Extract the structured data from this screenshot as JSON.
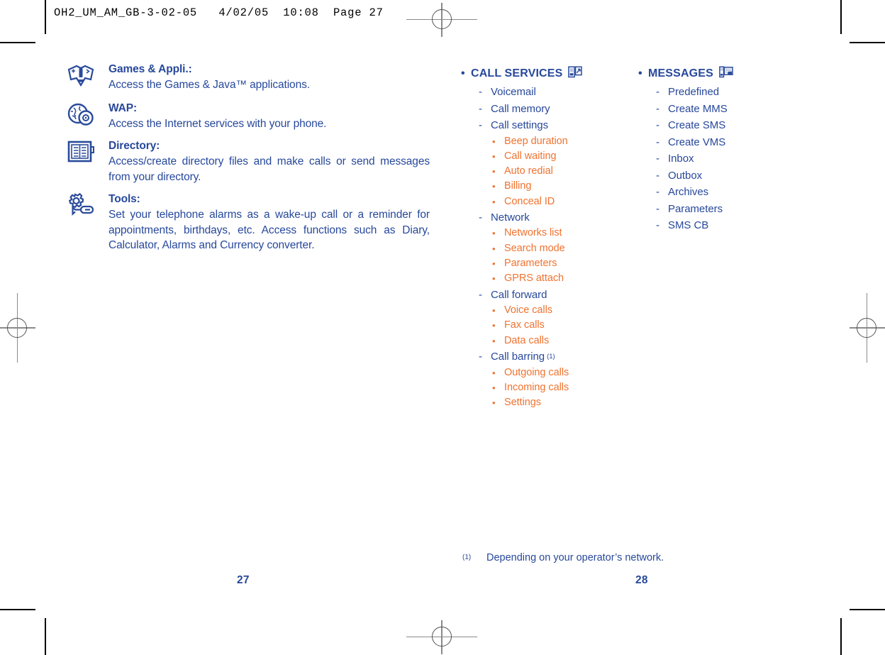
{
  "header": {
    "slug": "OH2_UM_AM_GB-3-02-05   4/02/05  10:08  Page 27"
  },
  "left_page": {
    "folio": "27",
    "features": [
      {
        "icon": "games-controller-icon",
        "title": "Games & Appli.:",
        "description": "Access the Games & Java™ applications.",
        "justify": false
      },
      {
        "icon": "wap-globe-icon",
        "title": "WAP:",
        "description": "Access the Internet services with your phone.",
        "justify": false
      },
      {
        "icon": "directory-book-icon",
        "title": "Directory:",
        "description": "Access/create directory files and make calls or send messages from your directory.",
        "justify": true
      },
      {
        "icon": "tools-gear-icon",
        "title": "Tools:",
        "description": "Set your telephone alarms as a wake-up call or a reminder for appointments, birthdays, etc. Access functions such as Diary, Calculator, Alarms and Currency converter.",
        "justify": true
      }
    ]
  },
  "right_page": {
    "folio": "28",
    "bullet_char": "•",
    "dash_char": "-",
    "columns": [
      {
        "heading": "CALL SERVICES",
        "heading_icon": "phone-transfer-icon",
        "items": [
          {
            "label": "Voicemail",
            "children": []
          },
          {
            "label": "Call memory",
            "children": []
          },
          {
            "label": "Call settings",
            "children": [
              "Beep duration",
              "Call waiting",
              "Auto redial",
              "Billing",
              "Conceal ID"
            ]
          },
          {
            "label": "Network",
            "children": [
              "Networks list",
              "Search mode",
              "Parameters",
              "GPRS attach"
            ]
          },
          {
            "label": "Call forward",
            "children": [
              "Voice calls",
              "Fax calls",
              "Data calls"
            ]
          },
          {
            "label": "Call barring",
            "footnote_mark": "(1)",
            "children": [
              "Outgoing calls",
              "Incoming calls",
              "Settings"
            ]
          }
        ]
      },
      {
        "heading": "MESSAGES",
        "heading_icon": "message-envelope-icon",
        "items": [
          {
            "label": "Predefined",
            "children": []
          },
          {
            "label": "Create MMS",
            "children": []
          },
          {
            "label": "Create SMS",
            "children": []
          },
          {
            "label": "Create VMS",
            "children": []
          },
          {
            "label": "Inbox",
            "children": []
          },
          {
            "label": "Outbox",
            "children": []
          },
          {
            "label": "Archives",
            "children": []
          },
          {
            "label": "Parameters",
            "children": []
          },
          {
            "label": "SMS CB",
            "children": []
          }
        ]
      }
    ],
    "footnote": {
      "mark": "(1)",
      "text": "Depending on your operator’s network."
    }
  },
  "colors": {
    "navy": "#27489b",
    "orange": "#ef7330",
    "black": "#000000"
  }
}
